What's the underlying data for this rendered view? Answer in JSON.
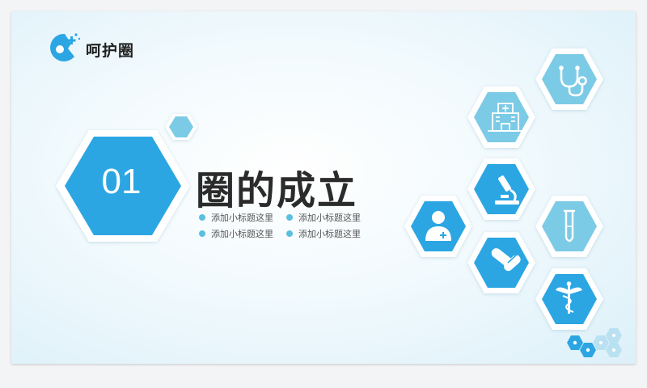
{
  "brand": {
    "name": "呵护圈",
    "accent": "#2ba6e3",
    "accent_light": "#7ccbe6"
  },
  "section": {
    "number": "01",
    "title": "圈的成立",
    "subtitles": [
      "添加小标题这里",
      "添加小标题这里",
      "添加小标题这里",
      "添加小标题这里"
    ]
  },
  "icons": [
    "stethoscope-icon",
    "hospital-icon",
    "microscope-icon",
    "doctor-icon",
    "test-tube-icon",
    "pills-icon",
    "caduceus-icon"
  ]
}
